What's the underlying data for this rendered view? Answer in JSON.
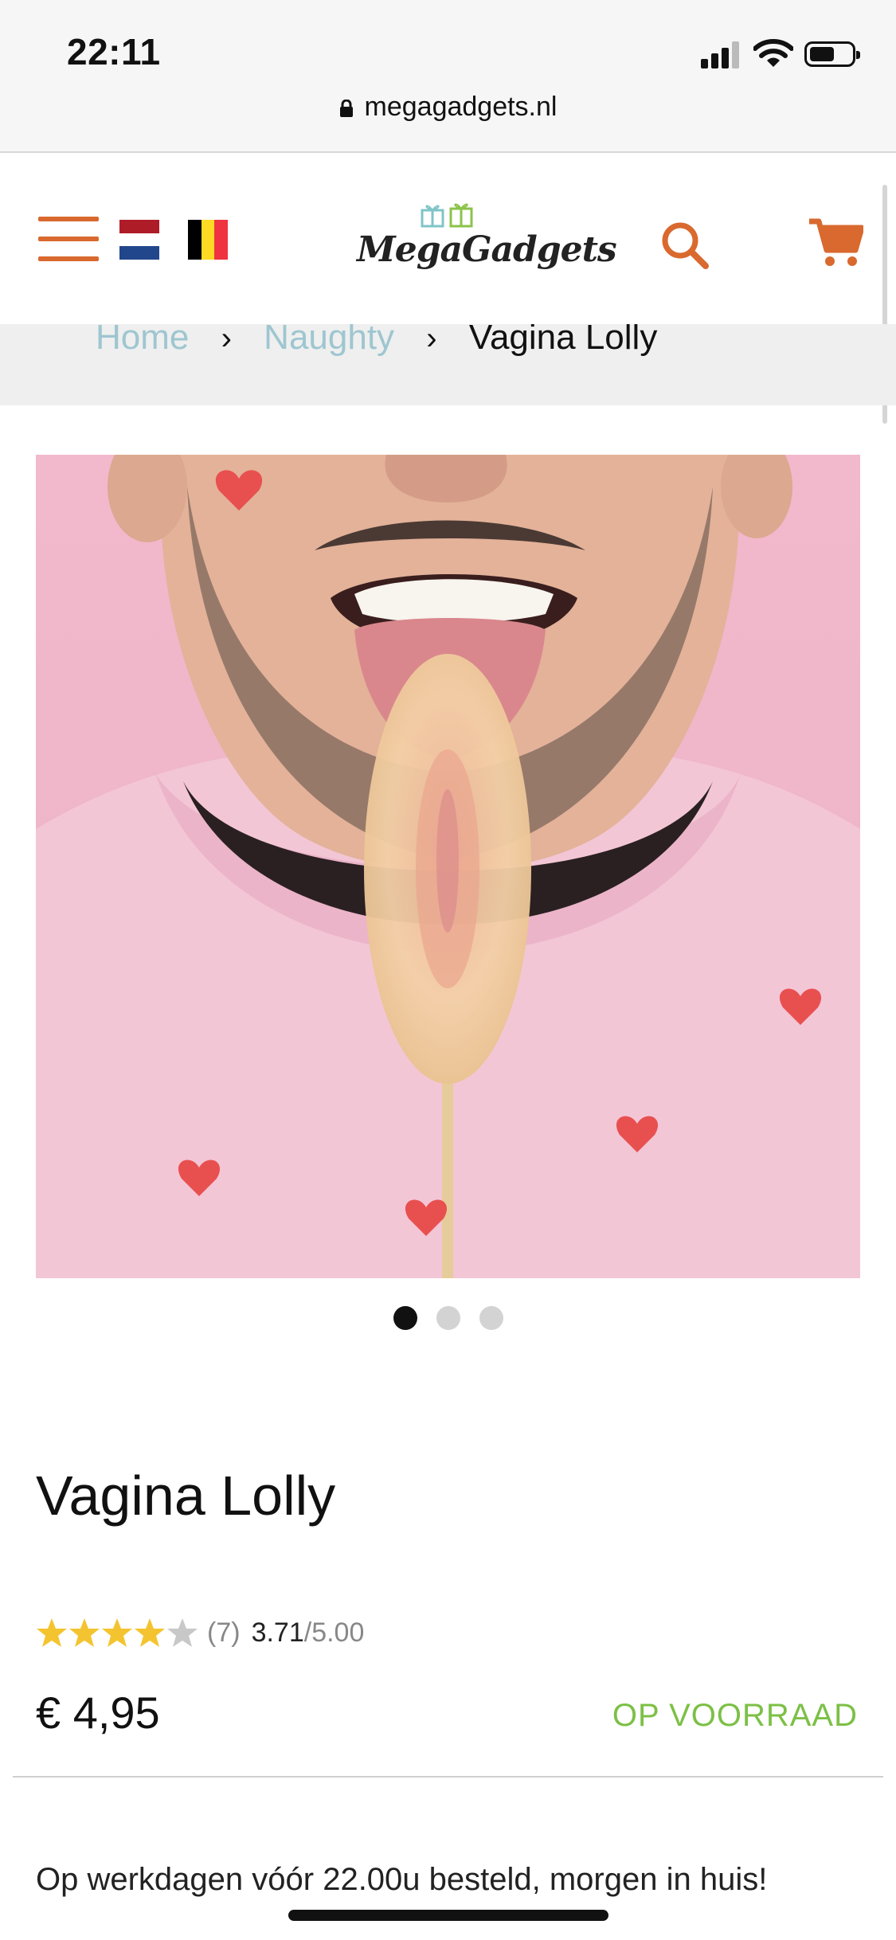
{
  "status_bar": {
    "time": "22:11"
  },
  "browser": {
    "url": "megagadgets.nl"
  },
  "header": {
    "logo_text": "MegaGadgets"
  },
  "breadcrumb": {
    "home": "Home",
    "category": "Naughty",
    "current": "Vagina Lolly"
  },
  "carousel": {
    "slides": 3,
    "active": 0
  },
  "product": {
    "title": "Vagina Lolly",
    "rating_count": "(7)",
    "rating_score": "3.71",
    "rating_max": "/5.00",
    "rating_value": 3.71,
    "price": "€ 4,95",
    "stock_status": "OP VOORRAAD",
    "delivery_note": "Op werkdagen vóór 22.00u besteld, morgen in huis!"
  },
  "colors": {
    "accent": "#d9692e",
    "in_stock": "#7cc046",
    "link": "#9ec6d0",
    "star": "#f4c430"
  },
  "icons": [
    "menu-icon",
    "dutch-flag-icon",
    "belgian-flag-icon",
    "search-icon",
    "cart-icon",
    "lock-icon"
  ]
}
